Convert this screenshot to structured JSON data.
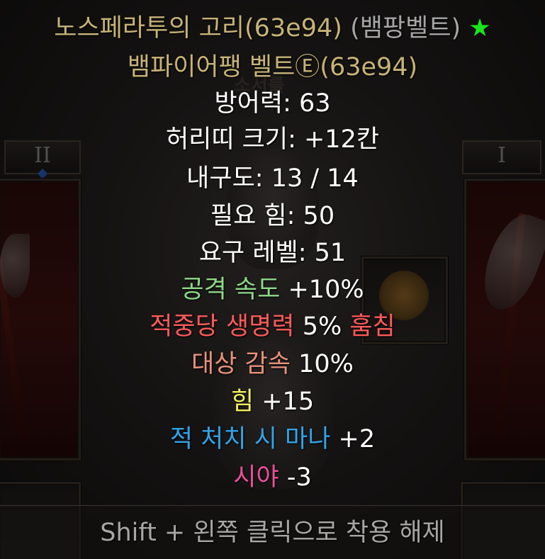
{
  "colors": {
    "unique_gold": "#c7b377",
    "base_gray": "#a6a6a6",
    "star_green": "#19e619",
    "white": "#ffffff",
    "attack_speed_green": "#8fd88a",
    "life_steal_red": "#ff5a5a",
    "slow_target_salmon": "#e8917a",
    "strength_yellow": "#f0f060",
    "mana_blue": "#33a3e8",
    "light_radius_pink": "#ec4f9a",
    "footer_gray": "#a6a6a6"
  },
  "tooltip": {
    "title": {
      "name": "노스페라투의 고리(63e94)",
      "type_tag": "(뱀팡벨트)",
      "star": "★"
    },
    "base_name": "뱀파이어팽 벨트Ⓔ(63e94)",
    "stats": {
      "defense": "방어력: 63",
      "belt_size": "허리띠 크기: +12칸",
      "durability": "내구도: 13 / 14",
      "required_strength": "필요 힘: 50",
      "required_level": "요구 레벨: 51"
    },
    "mods": [
      {
        "label": "공격 속도",
        "value": " +10%",
        "suffix": "",
        "color_key": "attack_speed_green"
      },
      {
        "label": "적중당 생명력",
        "value": " 5% ",
        "suffix": "훔침",
        "color_key": "life_steal_red"
      },
      {
        "label": "대상 감속",
        "value": " 10%",
        "suffix": "",
        "color_key": "slow_target_salmon"
      },
      {
        "label": "힘",
        "value": " +15",
        "suffix": "",
        "color_key": "strength_yellow"
      },
      {
        "label": "적 처치 시 마나",
        "value": " +2",
        "suffix": "",
        "color_key": "mana_blue"
      },
      {
        "label": "시야",
        "value": " -3",
        "suffix": "",
        "color_key": "light_radius_pink"
      }
    ]
  },
  "footer": {
    "hint": "Shift + 왼쪽 클릭으로 착용 해제"
  },
  "background": {
    "tab_left_label": "II",
    "tab_right_label": "I",
    "header_fragment": "소서를"
  },
  "icons": {
    "star": "star-icon",
    "sun": "sun-amulet-icon",
    "axe": "axe-icon"
  }
}
